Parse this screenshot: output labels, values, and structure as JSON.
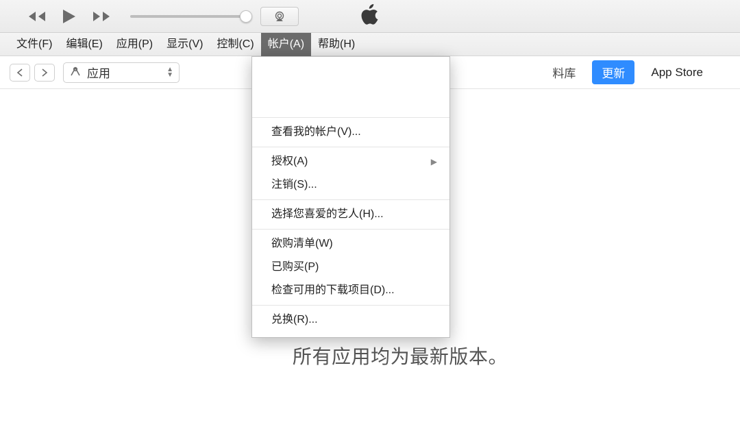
{
  "menu": {
    "items": [
      "文件(F)",
      "编辑(E)",
      "应用(P)",
      "显示(V)",
      "控制(C)",
      "帐户(A)",
      "帮助(H)"
    ],
    "active_index": 5
  },
  "selector": {
    "label": "应用"
  },
  "subbar": {
    "library_label": "料库",
    "update_label": "更新",
    "appstore_label": "App Store"
  },
  "dropdown": {
    "account_info_1": "",
    "account_info_2": "",
    "view_account": "查看我的帐户(V)...",
    "authorize": "授权(A)",
    "deauthorize": "注销(S)...",
    "favorite_artists": "选择您喜爱的艺人(H)...",
    "wishlist": "欲购清单(W)",
    "purchased": "已购买(P)",
    "check_downloads": "检查可用的下载项目(D)...",
    "redeem": "兑换(R)..."
  },
  "main": {
    "status": "所有应用均为最新版本。"
  },
  "icons": {
    "prev": "prev-icon",
    "play": "play-icon",
    "next": "next-icon",
    "airplay": "airplay-icon",
    "apple": "apple-logo-icon",
    "nav_back": "chevron-left-icon",
    "nav_fwd": "chevron-right-icon",
    "apps": "apps-icon"
  }
}
